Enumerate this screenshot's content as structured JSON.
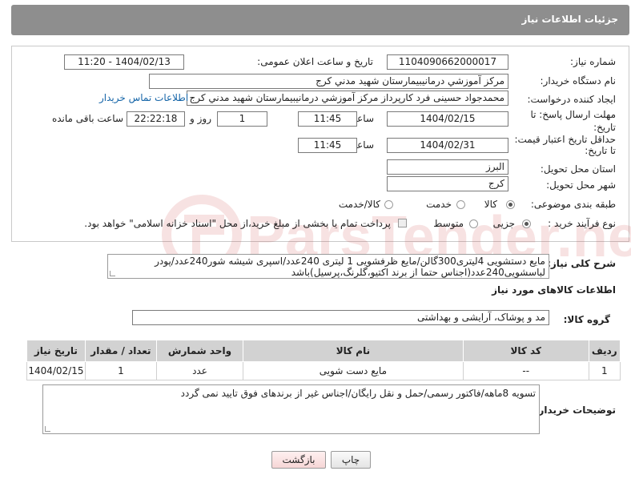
{
  "header": {
    "title": "جزئیات اطلاعات نیاز"
  },
  "form": {
    "need_number": {
      "label": "شماره نیاز:",
      "value": "1104090662000017"
    },
    "announce_datetime": {
      "label": "تاریخ و ساعت اعلان عمومی:",
      "value": "1404/02/13 - 11:20"
    },
    "buyer_org": {
      "label": "نام دستگاه خریدار:",
      "value": "مرکز آموزشي درمانيبيمارستان شهيد مدني کرج"
    },
    "creator": {
      "label": "ایجاد کننده درخواست:",
      "value": "محمدجواد حسینی فرد کارپرداز مرکز آموزشي درمانيبيمارستان شهيد مدني کرج",
      "contact_link": "اطلاعات تماس خریدار"
    },
    "reply_deadline": {
      "label": "مهلت ارسال پاسخ: تا تاریخ:",
      "date": "1404/02/15",
      "time_label": "ساعت",
      "time": "11:45",
      "days": "1",
      "days_label": "روز و",
      "remaining": "22:22:18",
      "remaining_label": "ساعت باقی مانده"
    },
    "price_validity": {
      "label": "حداقل تاریخ اعتبار قیمت: تا تاریخ:",
      "date": "1404/02/31",
      "time_label": "ساعت",
      "time": "11:45"
    },
    "delivery_province": {
      "label": "استان محل تحویل:",
      "value": "البرز"
    },
    "delivery_city": {
      "label": "شهر محل تحویل:",
      "value": "کرج"
    },
    "category": {
      "label": "طبقه بندی موضوعی:",
      "options": [
        "کالا",
        "خدمت",
        "کالا/خدمت"
      ],
      "selected": "کالا"
    },
    "purchase_type": {
      "label": "نوع فرآیند خرید :",
      "options": [
        "جزیی",
        "متوسط"
      ],
      "selected": "جزیی",
      "note": "پرداخت تمام یا بخشی از مبلغ خرید،از محل \"اسناد خزانه اسلامی\" خواهد بود."
    }
  },
  "description": {
    "label": "شرح کلی نیاز:",
    "line1": "مایع دستشویی 4لیتری300گالن/مایع ظرفشویی 1 لیتری 240عدد/اسپری شیشه شور240عدد/پودر",
    "line2": "لباسشویی240عدد(اجناس حتما از برند اکتیو،گلرنگ،پرسیل)باشد"
  },
  "goods_info": {
    "title": "اطلاعات کالاهای مورد نیاز",
    "group_label": "گروه کالا:",
    "group_value": "مد و پوشاک، آرایشی و بهداشتی"
  },
  "table": {
    "headers": [
      "ردیف",
      "کد کالا",
      "نام کالا",
      "واحد شمارش",
      "تعداد / مقدار",
      "تاریخ نیاز"
    ],
    "rows": [
      [
        "1",
        "--",
        "مایع دست شویی",
        "عدد",
        "1",
        "1404/02/15"
      ]
    ]
  },
  "buyer_notes": {
    "label": "توضیحات خریدار:",
    "value": "تسویه 8ماهه/فاکتور رسمی/حمل و نقل رایگان/اجناس غیر از برندهای فوق تایید نمی گردد"
  },
  "buttons": {
    "print": "چاپ",
    "back": "بازگشت"
  },
  "watermark": {
    "text": "ParsTender.net"
  }
}
